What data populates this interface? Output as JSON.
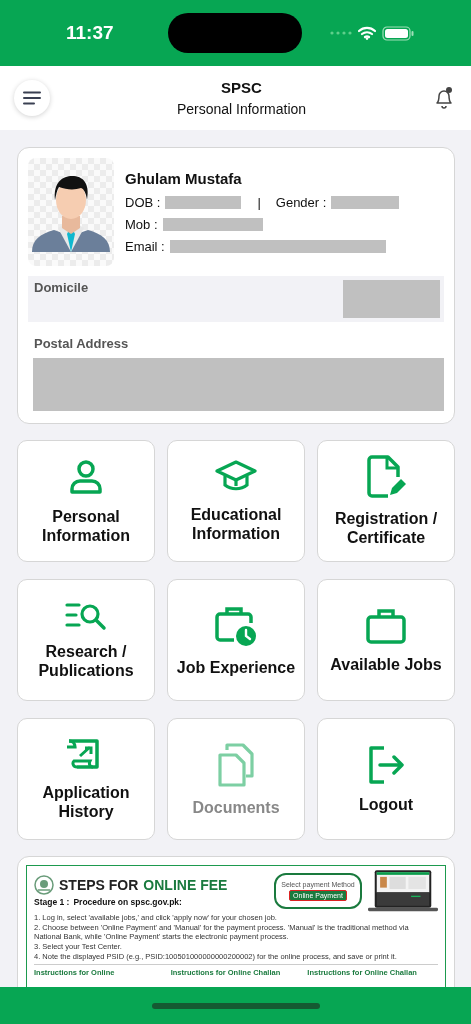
{
  "status_bar": {
    "time": "11:37"
  },
  "header": {
    "title": "SPSC",
    "subtitle": "Personal Information",
    "notification_dot": true
  },
  "profile": {
    "name": "Ghulam Mustafa",
    "dob_label": "DOB :",
    "separator": "|",
    "gender_label": "Gender :",
    "mobile_label": "Mob :",
    "email_label": "Email :",
    "domicile_label": "Domicile",
    "postal_label": "Postal Address"
  },
  "tiles": [
    {
      "kind": "person",
      "label": "Personal Information",
      "disabled": false
    },
    {
      "kind": "education",
      "label": "Educational Information",
      "disabled": false
    },
    {
      "kind": "certificate",
      "label": "Registration / Certificate",
      "disabled": false
    },
    {
      "kind": "research",
      "label": "Research / Publications",
      "disabled": false
    },
    {
      "kind": "experience",
      "label": "Job Experience",
      "disabled": false
    },
    {
      "kind": "jobs",
      "label": "Available Jobs",
      "disabled": false
    },
    {
      "kind": "history",
      "label": "Application History",
      "disabled": false
    },
    {
      "kind": "documents",
      "label": "Documents",
      "disabled": true
    },
    {
      "kind": "logout",
      "label": "Logout",
      "disabled": false
    }
  ],
  "banner": {
    "title_plain": "STEPS FOR",
    "title_accent": "ONLINE FEE",
    "stage_label": "Stage 1 :",
    "stage_title": "Procedure on spsc.gov.pk:",
    "steps": [
      "1. Log in, select 'available jobs,' and click 'apply now' for your chosen job.",
      "2. Choose between 'Online Payment' and 'Manual' for the payment process. 'Manual' is the traditional method via National Bank, while 'Online Payment' starts the electronic payment process.",
      "3. Select your Test Center.",
      "4. Note the displayed PSID (e.g., PSID:100501000000000200002) for the online process, and save or print it."
    ],
    "bubble_text": "Select payment Method",
    "bubble_button": "Online Payment",
    "columns": [
      "Instructions for Online",
      "Instructions for Online Challan",
      "Instructions for Online Challan"
    ]
  }
}
